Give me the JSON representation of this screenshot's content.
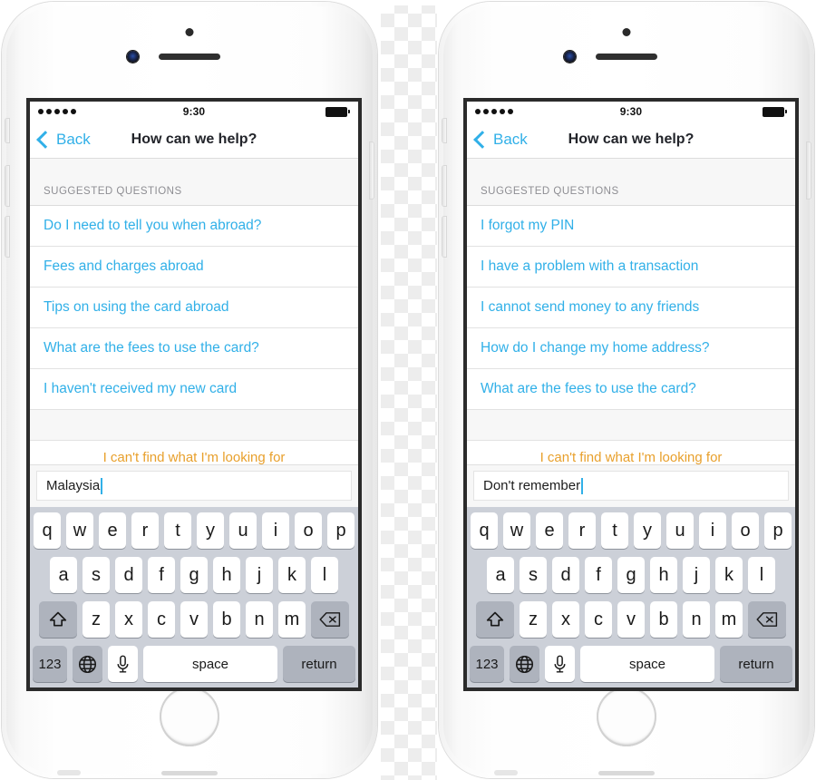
{
  "meta": {
    "device": "iphone-6-silver",
    "screens": 2,
    "accent_blue": "#31b0e8",
    "accent_orange": "#e8a02c",
    "keyboard_bg": "#ccd0d8",
    "section_bg": "#f7f7f7"
  },
  "status_bar": {
    "signal_dots": 5,
    "time": "9:30",
    "battery": "full"
  },
  "nav": {
    "back_label": "Back",
    "title": "How can we help?"
  },
  "section": {
    "header": "SUGGESTED QUESTIONS",
    "cant_find_label": "I can't find what I'm looking for"
  },
  "phones": [
    {
      "id": "phone-left",
      "questions": [
        "Do I need to tell you when abroad?",
        "Fees and charges abroad",
        "Tips on using the card abroad",
        "What are the fees to use the card?",
        "I haven't received my new card"
      ],
      "input": {
        "value": "Malaysia",
        "placeholder": ""
      }
    },
    {
      "id": "phone-right",
      "questions": [
        "I forgot my PIN",
        "I have a problem with a transaction",
        "I cannot send money to any friends",
        "How do I change my home address?",
        "What are the fees to use the card?"
      ],
      "input": {
        "value": "Don't remember",
        "placeholder": ""
      }
    }
  ],
  "keyboard": {
    "row1": [
      "q",
      "w",
      "e",
      "r",
      "t",
      "y",
      "u",
      "i",
      "o",
      "p"
    ],
    "row2": [
      "a",
      "s",
      "d",
      "f",
      "g",
      "h",
      "j",
      "k",
      "l"
    ],
    "row3": [
      "z",
      "x",
      "c",
      "v",
      "b",
      "n",
      "m"
    ],
    "shift_label": "shift",
    "delete_label": "delete",
    "numbers_label": "123",
    "globe_label": "globe",
    "mic_label": "dictation",
    "space_label": "space",
    "return_label": "return"
  }
}
